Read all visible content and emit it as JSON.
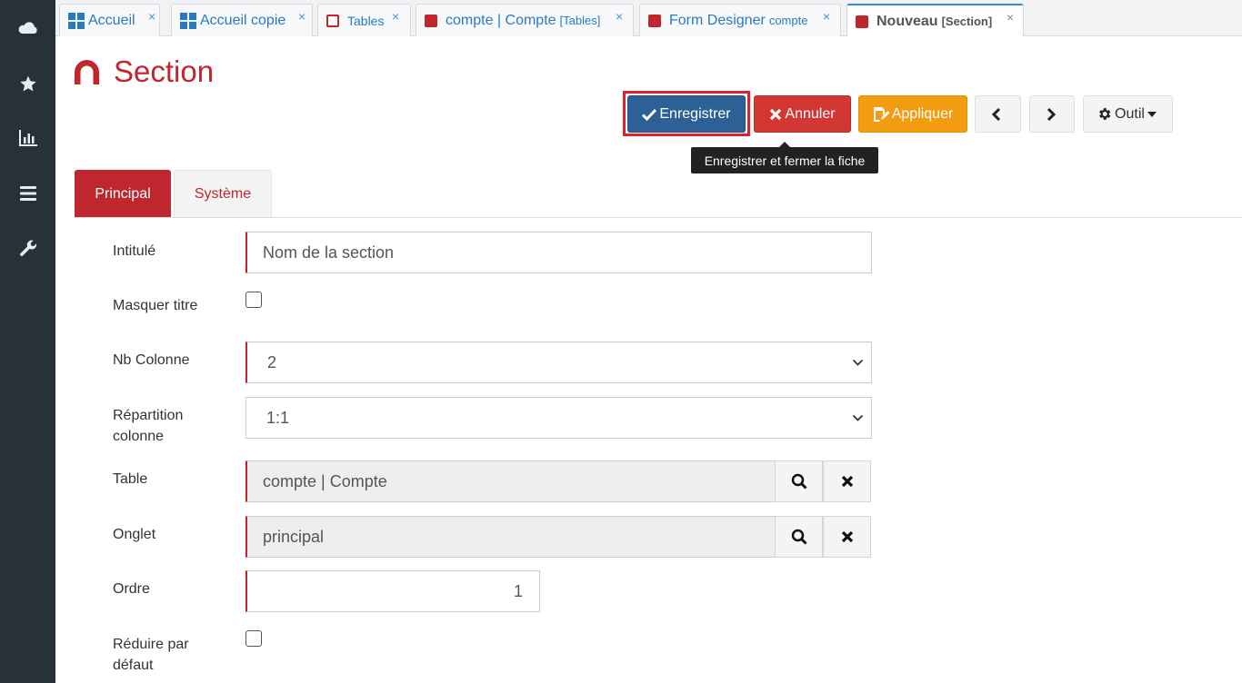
{
  "sidebar": {
    "icons": [
      "cloud-icon",
      "star-icon",
      "chart-icon",
      "menu-icon",
      "wrench-icon"
    ]
  },
  "tabs": [
    {
      "label": "Accueil",
      "sub": ""
    },
    {
      "label": "Accueil copie",
      "sub": ""
    },
    {
      "label": "Tables",
      "sub": ""
    },
    {
      "label": "compte | Compte",
      "sub": "[Tables]"
    },
    {
      "label": "Form Designer",
      "sub": "compte"
    },
    {
      "label": "Nouveau",
      "sub": "[Section]",
      "active": true
    }
  ],
  "close_glyph": "×",
  "page": {
    "title": "Section"
  },
  "toolbar": {
    "save": "Enregistrer",
    "cancel": "Annuler",
    "apply": "Appliquer",
    "tool": "Outil",
    "tooltip": "Enregistrer et fermer la fiche"
  },
  "form_tabs": {
    "principal": "Principal",
    "systeme": "Système"
  },
  "form": {
    "intitule": {
      "label": "Intitulé",
      "value": "Nom de la section"
    },
    "masquer_titre": {
      "label": "Masquer titre",
      "checked": false
    },
    "nb_colonne": {
      "label": "Nb Colonne",
      "value": "2"
    },
    "repartition": {
      "label_1": "Répartition",
      "label_2": "colonne",
      "value": "1:1"
    },
    "table": {
      "label": "Table",
      "value": "compte | Compte"
    },
    "onglet": {
      "label": "Onglet",
      "value": "principal"
    },
    "ordre": {
      "label": "Ordre",
      "value": "1"
    },
    "reduire": {
      "label_1": "Réduire par",
      "label_2": "défaut",
      "checked": false
    }
  },
  "colors": {
    "brand_red": "#c0262d",
    "save_blue": "#2d6196",
    "cancel_red": "#d33733",
    "apply_orange": "#f39c12",
    "sidebar": "#263238"
  }
}
